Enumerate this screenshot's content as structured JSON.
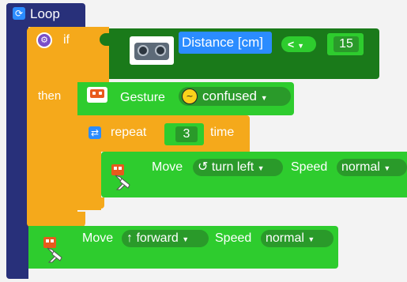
{
  "loop": {
    "label": "Loop"
  },
  "if_block": {
    "if_label": "if",
    "then_label": "then"
  },
  "condition": {
    "sensor_label": "Distance [cm]",
    "operator": "<",
    "value": "15"
  },
  "gesture": {
    "label": "Gesture",
    "value": "confused"
  },
  "repeat": {
    "label": "repeat",
    "count": "3",
    "suffix": "time"
  },
  "move_inner": {
    "label": "Move",
    "direction_symbol": "↺",
    "direction": "turn left",
    "speed_label": "Speed",
    "speed": "normal"
  },
  "move_outer": {
    "label": "Move",
    "direction_symbol": "↑",
    "direction": "forward",
    "speed_label": "Speed",
    "speed": "normal"
  },
  "colors": {
    "loop": "#28307a",
    "control": "#f5a91b",
    "action": "#2ecc2e",
    "sensor": "#1a7a1a",
    "label_blue": "#2b8cff"
  },
  "icons": [
    "loop-icon",
    "gear-icon",
    "ultrasonic-sensor-icon",
    "robot-face-icon",
    "confused-emoji-icon",
    "repeat-icon",
    "robot-icon"
  ]
}
